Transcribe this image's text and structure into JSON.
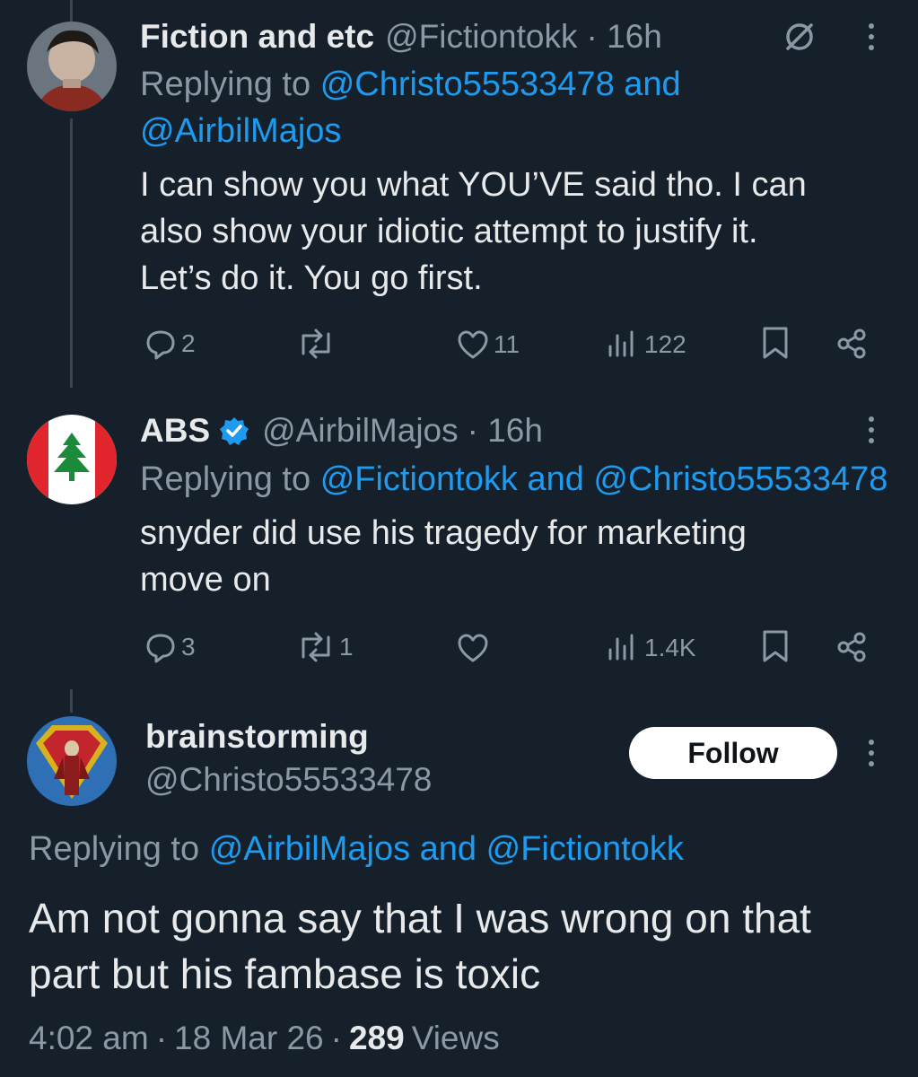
{
  "tweets": [
    {
      "name": "Fiction and etc",
      "handle": "@Fictiontokk",
      "time": "· 16h",
      "replying_prefix": "Replying to",
      "reply_mention_1": "@Christo55533478",
      "reply_and": "and",
      "reply_mention_2": "@AirbilMajos",
      "text_line_1": "I can show you what YOU’VE said tho. I can",
      "text_line_2": "also show your idiotic attempt to justify it.",
      "text_line_3": "Let’s do it. You go first.",
      "replies": "2",
      "reposts": "",
      "likes": "11",
      "views": "122"
    },
    {
      "name": "ABS",
      "handle": "@AirbilMajos",
      "time": "· 16h",
      "replying_prefix": "Replying to",
      "reply_mention_1": "@Fictiontokk",
      "reply_and": "and",
      "reply_mention_2": "@Christo55533478",
      "text_line_1": "snyder did use his tragedy for marketing",
      "text_line_2": "move on",
      "replies": "3",
      "reposts": "1",
      "likes": "",
      "views": "1.4K"
    }
  ],
  "main": {
    "name": "brainstorming",
    "handle": "@Christo55533478",
    "follow_label": "Follow",
    "replying_prefix": "Replying to",
    "reply_mention_1": "@AirbilMajos",
    "reply_and": "and",
    "reply_mention_2": "@Fictiontokk",
    "text_line_1": "Am not gonna say that I was wrong on that",
    "text_line_2": "part but his fambase is toxic",
    "time": "4:02 am",
    "date": "18 Mar 26",
    "sep": "·",
    "views_count": "289",
    "views_label": "Views"
  },
  "icons": [
    "grok-icon",
    "more-icon",
    "reply-icon",
    "repost-icon",
    "like-icon",
    "views-icon",
    "bookmark-icon",
    "share-icon",
    "verified-badge-icon"
  ],
  "colors": {
    "background": "#16202b",
    "link": "#1d9bf0",
    "muted": "#8b98a5",
    "verified": "#1d9bf0"
  }
}
